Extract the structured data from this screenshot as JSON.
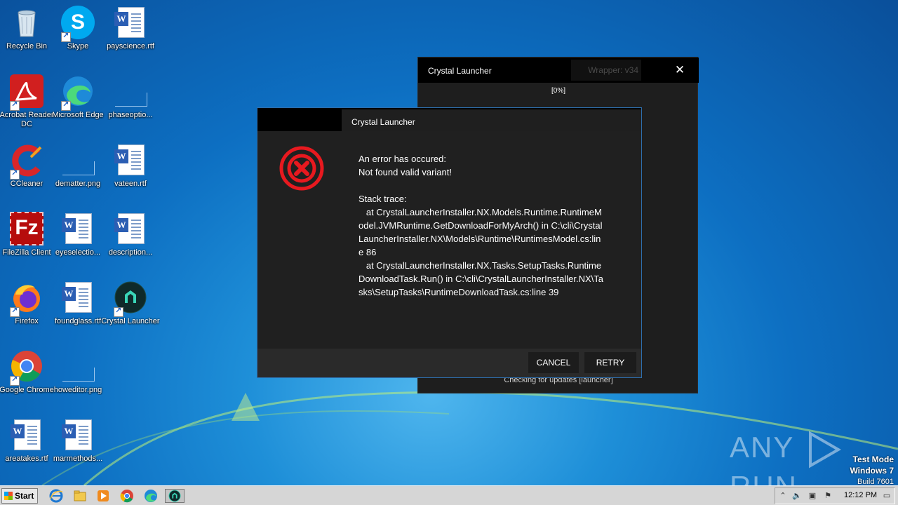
{
  "desktop": {
    "icons": [
      {
        "label": "Recycle Bin",
        "icon": "recycle-bin-icon"
      },
      {
        "label": "Skype",
        "icon": "skype-icon"
      },
      {
        "label": "payscience.rtf",
        "icon": "word-doc-icon"
      },
      {
        "label": "Acrobat Reader DC",
        "icon": "acrobat-icon"
      },
      {
        "label": "Microsoft Edge",
        "icon": "edge-icon"
      },
      {
        "label": "phaseoptio...",
        "icon": "image-file-icon"
      },
      {
        "label": "CCleaner",
        "icon": "ccleaner-icon"
      },
      {
        "label": "dematter.png",
        "icon": "image-file-icon"
      },
      {
        "label": "vateen.rtf",
        "icon": "word-doc-icon"
      },
      {
        "label": "FileZilla Client",
        "icon": "filezilla-icon"
      },
      {
        "label": "eyeselectio...",
        "icon": "word-doc-icon"
      },
      {
        "label": "description...",
        "icon": "word-doc-icon"
      },
      {
        "label": "Firefox",
        "icon": "firefox-icon"
      },
      {
        "label": "foundglass.rtf",
        "icon": "word-doc-icon"
      },
      {
        "label": "Crystal Launcher",
        "icon": "crystal-launcher-icon"
      },
      {
        "label": "Google Chrome",
        "icon": "chrome-icon"
      },
      {
        "label": "howeditor.png",
        "icon": "image-file-icon"
      },
      {
        "label": "areatakes.rtf",
        "icon": "word-doc-icon"
      },
      {
        "label": "marmethods...",
        "icon": "word-doc-icon"
      }
    ]
  },
  "back_window": {
    "title": "Crystal Launcher",
    "wrapper_label": "Wrapper: v34",
    "progress": "[0%]",
    "status": "Checking for updates [launcher]",
    "close_glyph": "✕"
  },
  "error_dialog": {
    "title": "Crystal Launcher",
    "message": "An error has occured:\nNot found valid variant!\n\nStack trace:\n   at CrystalLauncherInstaller.NX.Models.Runtime.RuntimeModel.JVMRuntime.GetDownloadForMyArch() in C:\\cli\\CrystalLauncherInstaller.NX\\Models\\Runtime\\RuntimesModel.cs:line 86\n   at CrystalLauncherInstaller.NX.Tasks.SetupTasks.RuntimeDownloadTask.Run() in C:\\cli\\CrystalLauncherInstaller.NX\\Tasks\\SetupTasks\\RuntimeDownloadTask.cs:line 39",
    "cancel_label": "CANCEL",
    "retry_label": "RETRY",
    "icon": "error-x-icon",
    "error_color": "#e8191f"
  },
  "watermark": {
    "any": "ANY",
    "run": "RUN"
  },
  "test_mode": {
    "line1": "Test Mode",
    "line2": "Windows 7",
    "line3": "Build 7601"
  },
  "taskbar": {
    "start_label": "Start",
    "clock": "12:12 PM",
    "pinned": [
      "ie-icon",
      "explorer-icon",
      "media-player-icon",
      "chrome-icon",
      "edge-icon",
      "crystal-launcher-icon"
    ]
  }
}
